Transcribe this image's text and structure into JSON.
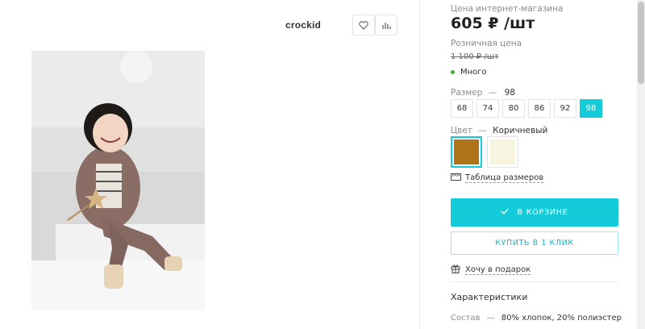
{
  "brand": {
    "name": "crockid"
  },
  "toolbar": {
    "favorite_icon": "heart-icon",
    "compare_icon": "bar-chart-icon"
  },
  "product": {
    "price_label": "Цена интернет-магазина",
    "price": "605 ₽ /шт",
    "retail_label": "Розничная цена",
    "retail_price": "1 100 ₽ /шт",
    "stock": "Много",
    "stock_color": "#35b51f"
  },
  "size": {
    "label": "Размер",
    "separator": "—",
    "selected": "98",
    "options": [
      "68",
      "74",
      "80",
      "86",
      "92",
      "98"
    ]
  },
  "color": {
    "label": "Цвет",
    "separator": "—",
    "selected": "Коричневый",
    "swatches": [
      "#b07418",
      "#f7f5df"
    ]
  },
  "links": {
    "size_table": "Таблица размеров",
    "gift": "Хочу в подарок"
  },
  "buttons": {
    "cart": "В КОРЗИНЕ",
    "one_click": "КУПИТЬ В 1 КЛИК"
  },
  "specs": {
    "title": "Характеристики",
    "composition_key": "Состав",
    "separator": "—",
    "composition_value": "80% хлопок, 20% полиэстер"
  },
  "accent_color": "#14ccd9"
}
